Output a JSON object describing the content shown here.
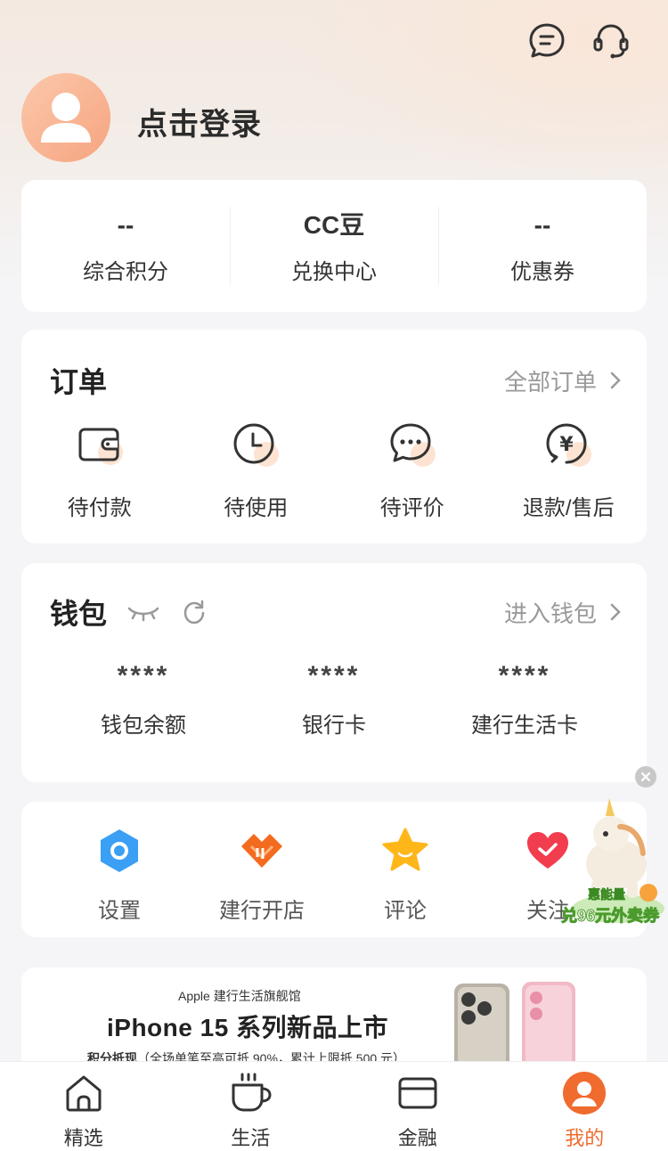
{
  "header": {
    "login_text": "点击登录",
    "message_icon": "message-icon",
    "service_icon": "headset-icon"
  },
  "stats": [
    {
      "value": "--",
      "label": "综合积分"
    },
    {
      "value": "CC豆",
      "label": "兑换中心"
    },
    {
      "value": "--",
      "label": "优惠券"
    }
  ],
  "orders": {
    "title": "订单",
    "link": "全部订单",
    "items": [
      {
        "label": "待付款",
        "icon": "wallet-icon"
      },
      {
        "label": "待使用",
        "icon": "clock-icon"
      },
      {
        "label": "待评价",
        "icon": "chat-icon"
      },
      {
        "label": "退款/售后",
        "icon": "refund-icon"
      }
    ]
  },
  "wallet": {
    "title": "钱包",
    "link": "进入钱包",
    "items": [
      {
        "value": "****",
        "label": "钱包余额"
      },
      {
        "value": "****",
        "label": "银行卡"
      },
      {
        "value": "****",
        "label": "建行生活卡"
      }
    ]
  },
  "tools": [
    {
      "label": "设置",
      "icon": "settings-icon"
    },
    {
      "label": "建行开店",
      "icon": "shop-icon"
    },
    {
      "label": "评论",
      "icon": "star-icon"
    },
    {
      "label": "关注",
      "icon": "heart-icon"
    }
  ],
  "float_ad": {
    "top_text": "惠能量",
    "text": "兑96元外卖券"
  },
  "banner": {
    "subtitle": "Apple 建行生活旗舰馆",
    "title": "iPhone 15 系列新品上市",
    "note_bold": "积分抵现",
    "note": "（全场单笔至高可抵 90%，累计上限抵 500 元）"
  },
  "tabs": [
    {
      "label": "精选",
      "icon": "home-icon"
    },
    {
      "label": "生活",
      "icon": "cup-icon"
    },
    {
      "label": "金融",
      "icon": "card-icon"
    },
    {
      "label": "我的",
      "icon": "profile-icon",
      "active": true
    }
  ],
  "colors": {
    "accent": "#f06b2e",
    "background": "#f5f5f7"
  }
}
